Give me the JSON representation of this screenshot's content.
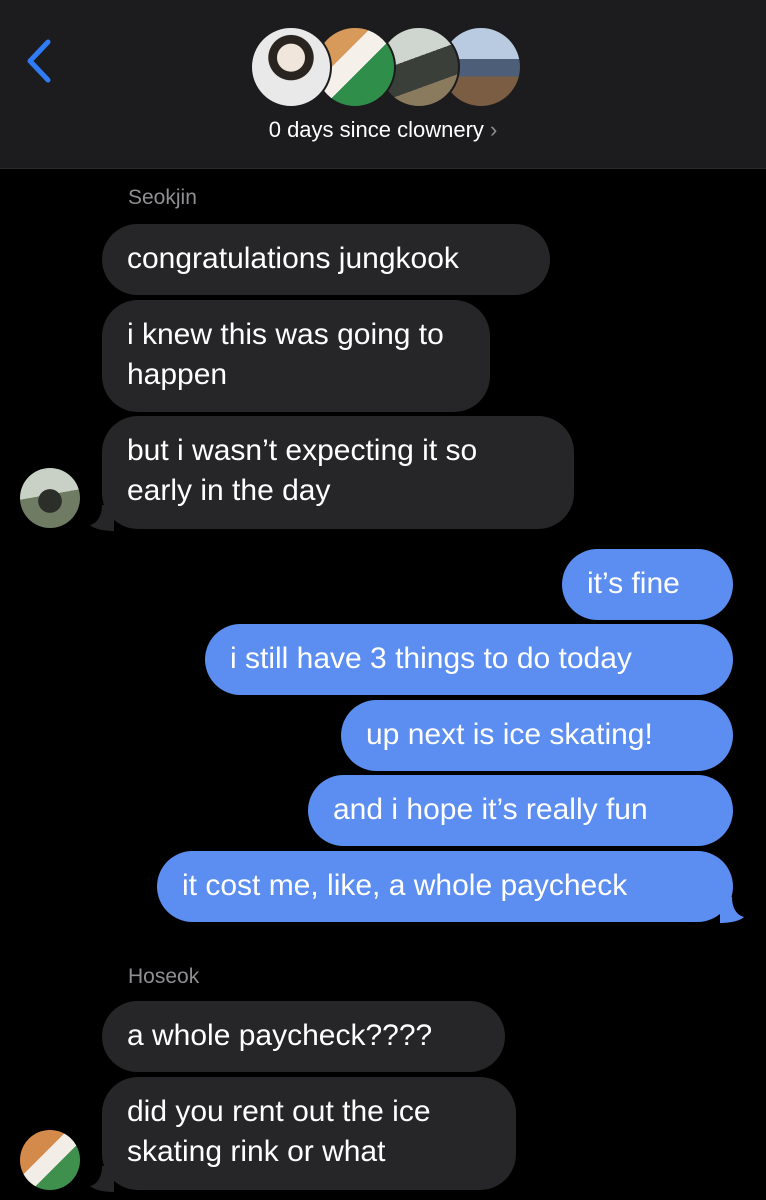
{
  "header": {
    "group_title": "0 days since clownery",
    "chevron": "›"
  },
  "icons": {
    "back": "chevron-left-icon",
    "accent": "#2f7cf6"
  },
  "colors": {
    "incoming_bubble": "#262628",
    "outgoing_bubble": "#5b8ef0",
    "sender_name": "#8e8e93"
  },
  "thread": {
    "seokjin": {
      "sender": "Seokjin",
      "messages": [
        "congratulations jungkook",
        "i knew this was going to happen",
        "but i wasn’t expecting it so early in the day"
      ]
    },
    "me": {
      "messages": [
        "it’s fine",
        "i still have 3 things to do today",
        "up next is ice skating!",
        "and i hope it’s really fun",
        "it cost me, like, a whole paycheck"
      ]
    },
    "hoseok": {
      "sender": "Hoseok",
      "messages": [
        "a whole paycheck????",
        "did you rent out the ice skating rink or what"
      ]
    }
  }
}
